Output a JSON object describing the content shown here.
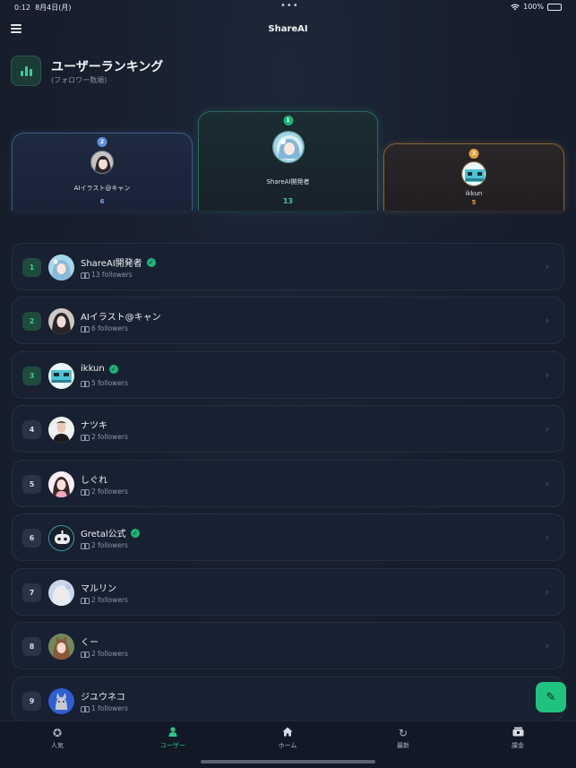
{
  "status": {
    "time": "0:12",
    "date": "8月4日(月)",
    "dots": "•••",
    "battery_text": "100%"
  },
  "app": {
    "title": "ShareAI"
  },
  "header": {
    "title": "ユーザーランキング",
    "subtitle": "(フォロワー数順)"
  },
  "podium": {
    "first": {
      "rank": "1",
      "name": "ShareAI開発者",
      "count": "13"
    },
    "second": {
      "rank": "2",
      "name": "AIイラスト@キャン",
      "count": "6"
    },
    "third": {
      "rank": "3",
      "name": "ikkun",
      "count": "5"
    }
  },
  "ranking": [
    {
      "rank": "1",
      "name": "ShareAI開発者",
      "followers": "13 followers",
      "verified": true
    },
    {
      "rank": "2",
      "name": "AIイラスト@キャン",
      "followers": "6 followers",
      "verified": false
    },
    {
      "rank": "3",
      "name": "ikkun",
      "followers": "5 followers",
      "verified": true
    },
    {
      "rank": "4",
      "name": "ナツキ",
      "followers": "2 followers",
      "verified": false
    },
    {
      "rank": "5",
      "name": "しぐれ",
      "followers": "2 followers",
      "verified": false
    },
    {
      "rank": "6",
      "name": "Gretal公式",
      "followers": "2 followers",
      "verified": true
    },
    {
      "rank": "7",
      "name": "マルリン",
      "followers": "2 followers",
      "verified": false
    },
    {
      "rank": "8",
      "name": "くー",
      "followers": "2 followers",
      "verified": false
    },
    {
      "rank": "9",
      "name": "ジユウネコ",
      "followers": "1 followers",
      "verified": false
    }
  ],
  "tabs": [
    {
      "label": "人気",
      "icon": "star-icon",
      "active": false
    },
    {
      "label": "ユーザー",
      "icon": "user-icon",
      "active": true
    },
    {
      "label": "ホーム",
      "icon": "home-icon",
      "active": false
    },
    {
      "label": "最新",
      "icon": "history-icon",
      "active": false
    },
    {
      "label": "課金",
      "icon": "wallet-icon",
      "active": false
    }
  ],
  "colors": {
    "accent": "#25c98a",
    "background": "#161d2b",
    "gold": "#e7a13b",
    "silver": "#6fa4e8"
  }
}
